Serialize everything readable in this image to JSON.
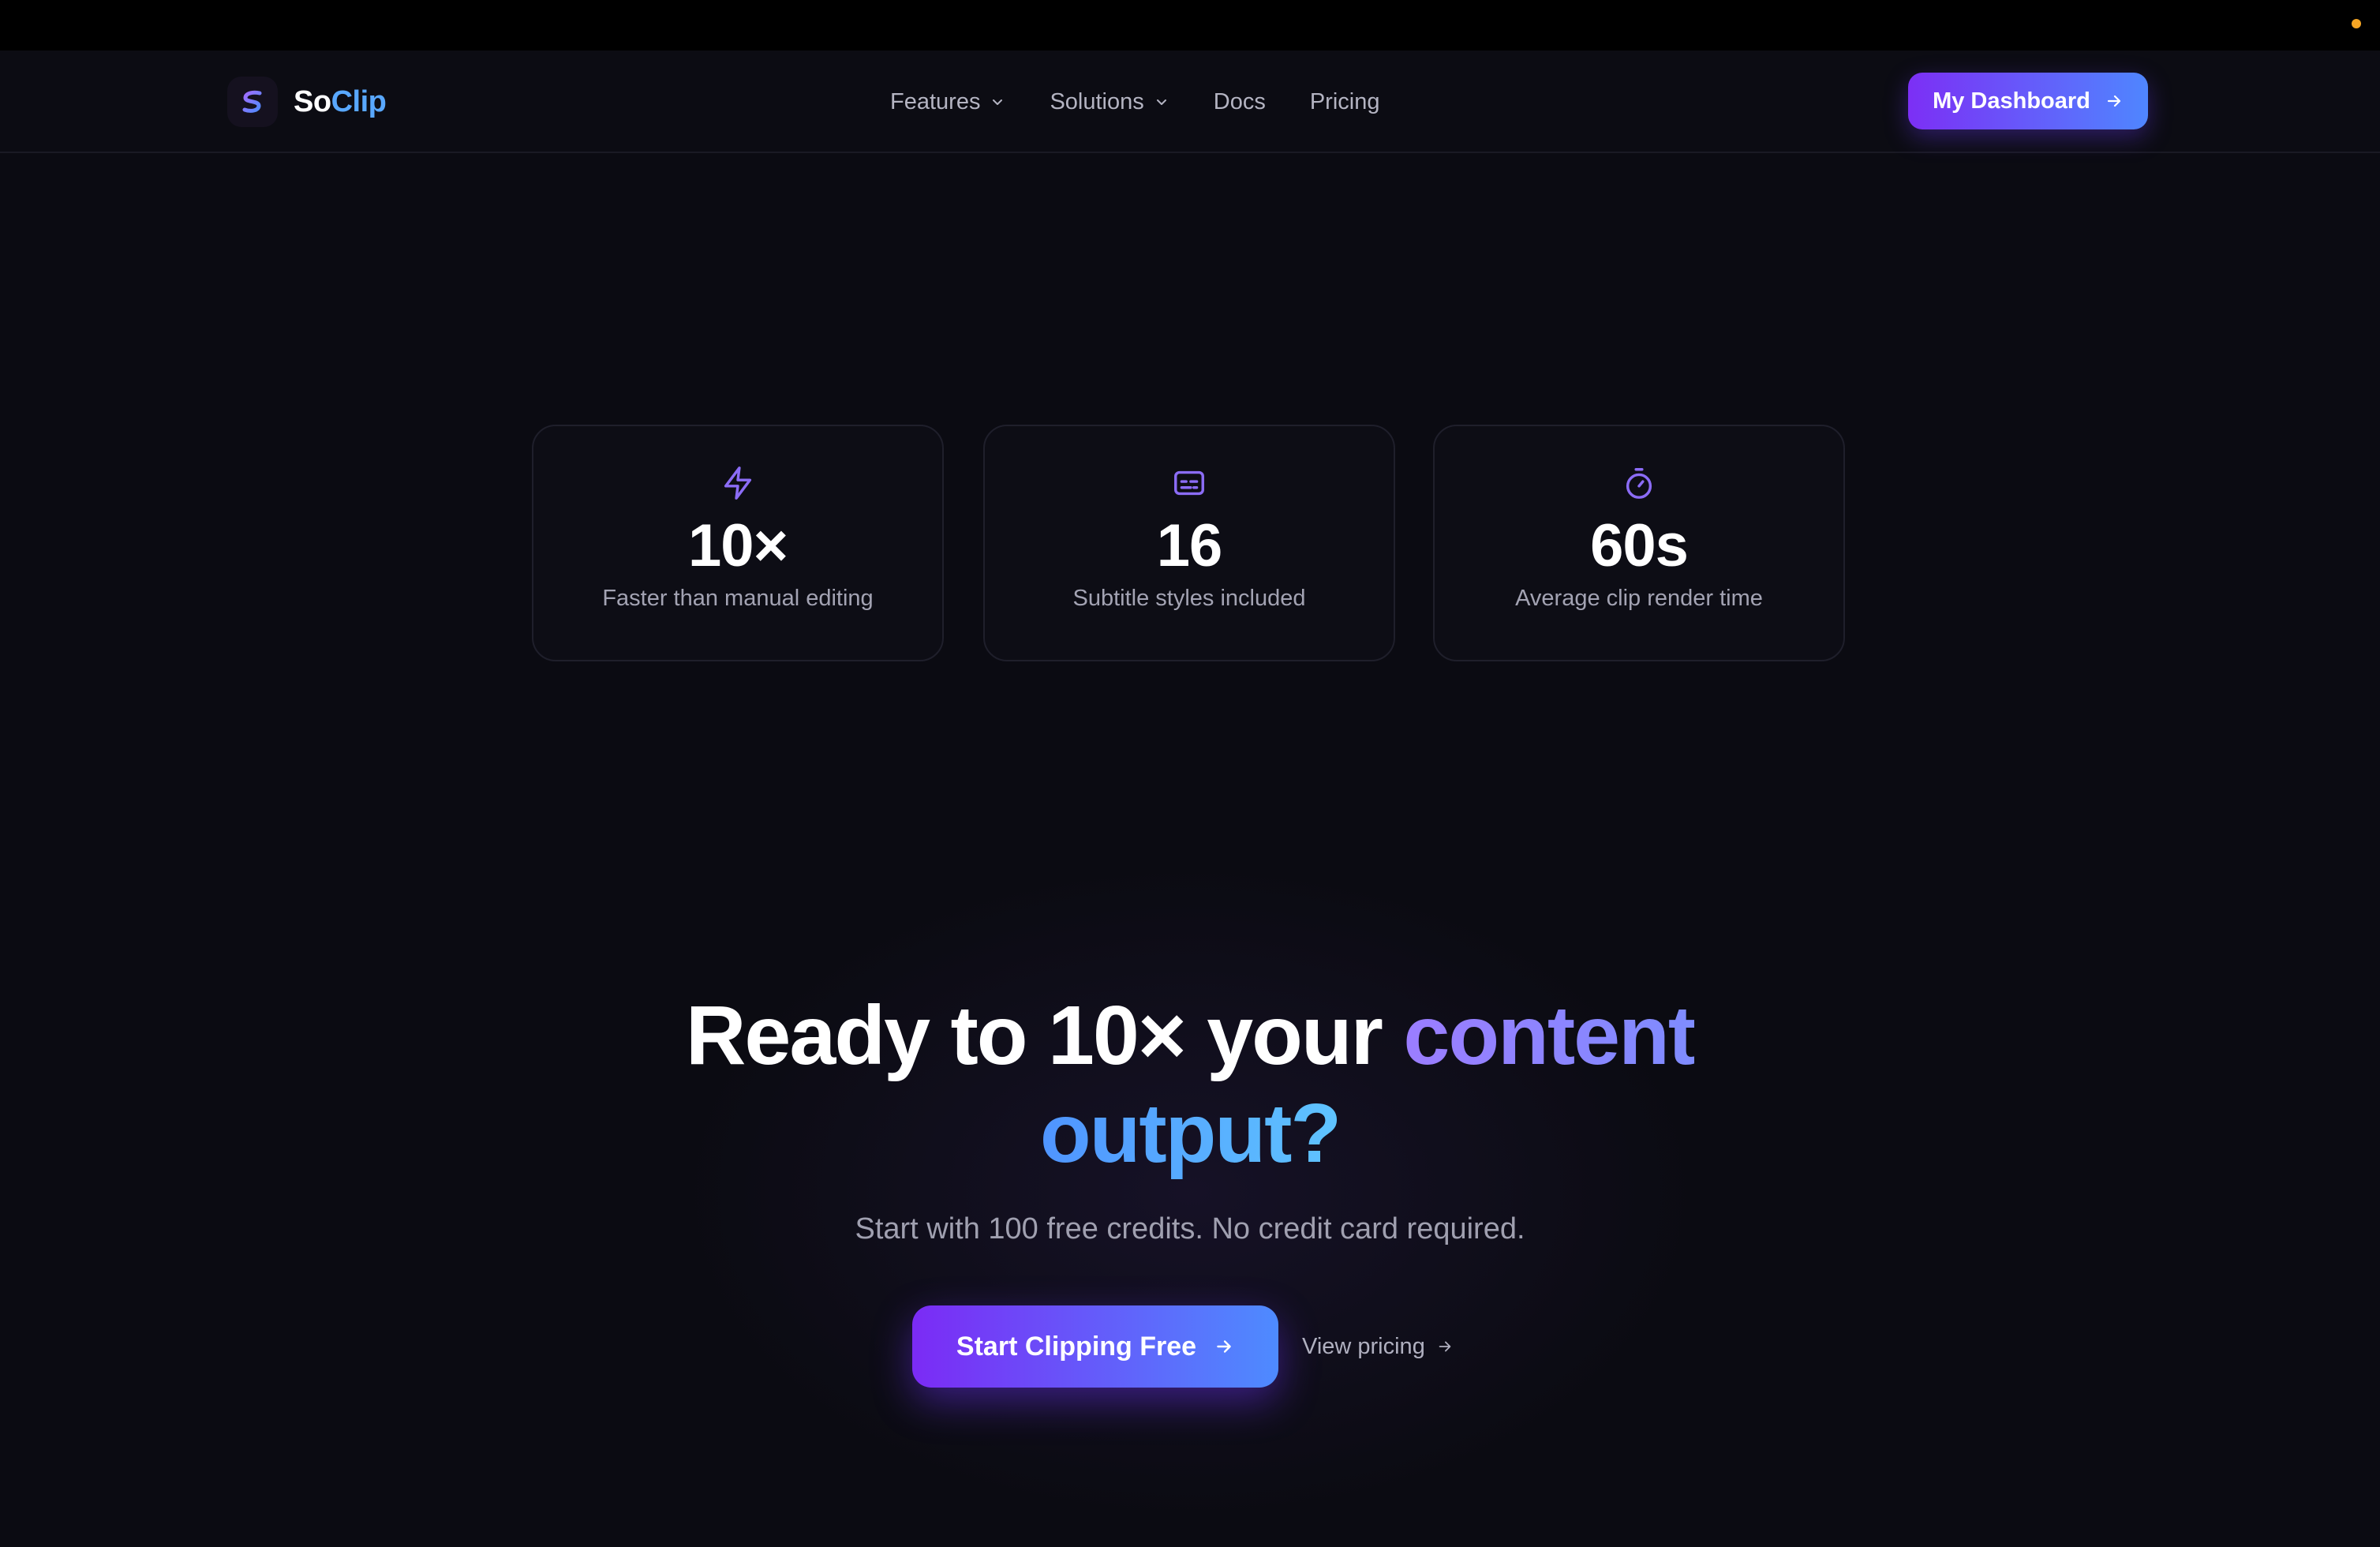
{
  "brand": {
    "name_part1": "So",
    "name_part2": "Clip",
    "logo_icon": "soclip-logo-icon"
  },
  "nav": {
    "items": [
      {
        "label": "Features",
        "has_dropdown": true
      },
      {
        "label": "Solutions",
        "has_dropdown": true
      },
      {
        "label": "Docs",
        "has_dropdown": false
      },
      {
        "label": "Pricing",
        "has_dropdown": false
      }
    ],
    "dashboard_button": {
      "label": "My Dashboard",
      "icon": "arrow-right-icon"
    }
  },
  "stats": [
    {
      "icon": "lightning-icon",
      "value": "10×",
      "label": "Faster than manual editing"
    },
    {
      "icon": "subtitles-icon",
      "value": "16",
      "label": "Subtitle styles included"
    },
    {
      "icon": "stopwatch-icon",
      "value": "60s",
      "label": "Average clip render time"
    }
  ],
  "cta": {
    "headline_plain": "Ready to 10× your ",
    "headline_grad1": "content",
    "headline_grad2": "output?",
    "subtitle": "Start with 100 free credits. No credit card required.",
    "primary_button": {
      "label": "Start Clipping Free",
      "icon": "arrow-right-icon"
    },
    "secondary_link": {
      "label": "View pricing",
      "icon": "arrow-right-icon"
    }
  },
  "colors": {
    "background": "#0b0b12",
    "accent_purple": "#7c2ff5",
    "accent_blue": "#4f86ff",
    "brand_clip_blue": "#59a8ff",
    "icon_purple": "#8b6cf6",
    "status_dot": "#f5a524"
  }
}
